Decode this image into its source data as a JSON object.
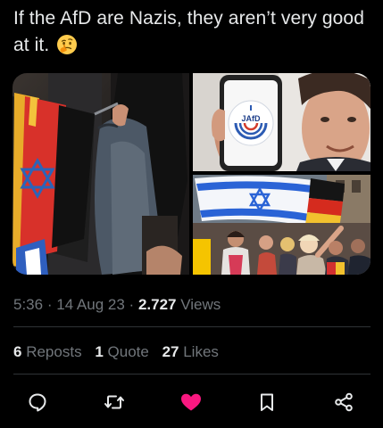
{
  "tweet": {
    "text": "If the AfD are Nazis, they aren’t very good at it.",
    "emoji": "thinking-face"
  },
  "media": {
    "image_1": "flag-with-star-of-david",
    "image_2": "phone-with-jafd-logo",
    "image_3": "crowd-with-israeli-and-german-flags",
    "phone_logo_text": "JAfD"
  },
  "meta": {
    "time": "5:36",
    "date": "14 Aug 23",
    "views_count": "2.727",
    "views_label": "Views",
    "separator": "·"
  },
  "stats": {
    "reposts_count": "6",
    "reposts_label": "Reposts",
    "quotes_count": "1",
    "quotes_label": "Quote",
    "likes_count": "27",
    "likes_label": "Likes"
  },
  "actions": {
    "icons": [
      "reply-icon",
      "repost-icon",
      "like-icon",
      "bookmark-icon",
      "share-icon"
    ],
    "like_active": true
  },
  "colors": {
    "background": "#000000",
    "text_primary": "#e7e9ea",
    "text_secondary": "#71767b",
    "divider": "#2f3336",
    "like_active": "#f91880"
  }
}
